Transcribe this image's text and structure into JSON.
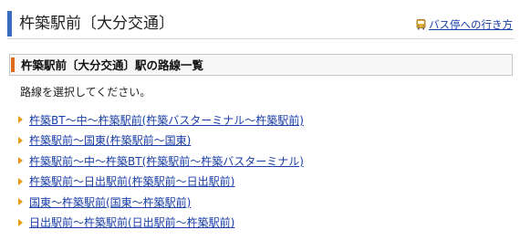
{
  "header": {
    "title": "杵築駅前〔大分交通〕",
    "link_label": "バス停への行き方",
    "icon": "bus-icon"
  },
  "section": {
    "heading": "杵築駅前〔大分交通〕駅の路線一覧"
  },
  "instruction": "路線を選択してください。",
  "routes": [
    {
      "label": "杵築BT〜中〜杵築駅前(杵築バスターミナル〜杵築駅前)"
    },
    {
      "label": "杵築駅前〜国東(杵築駅前〜国東)"
    },
    {
      "label": "杵築駅前〜中〜杵築BT(杵築駅前〜杵築バスターミナル)"
    },
    {
      "label": "杵築駅前〜日出駅前(杵築駅前〜日出駅前)"
    },
    {
      "label": "国東〜杵築駅前(国東〜杵築駅前)"
    },
    {
      "label": "日出駅前〜杵築駅前(日出駅前〜杵築駅前)"
    }
  ],
  "colors": {
    "header_accent": "#3a6cc0",
    "section_accent": "#e06a1c",
    "list_arrow": "#e89a14",
    "link": "#1a3ea8"
  }
}
